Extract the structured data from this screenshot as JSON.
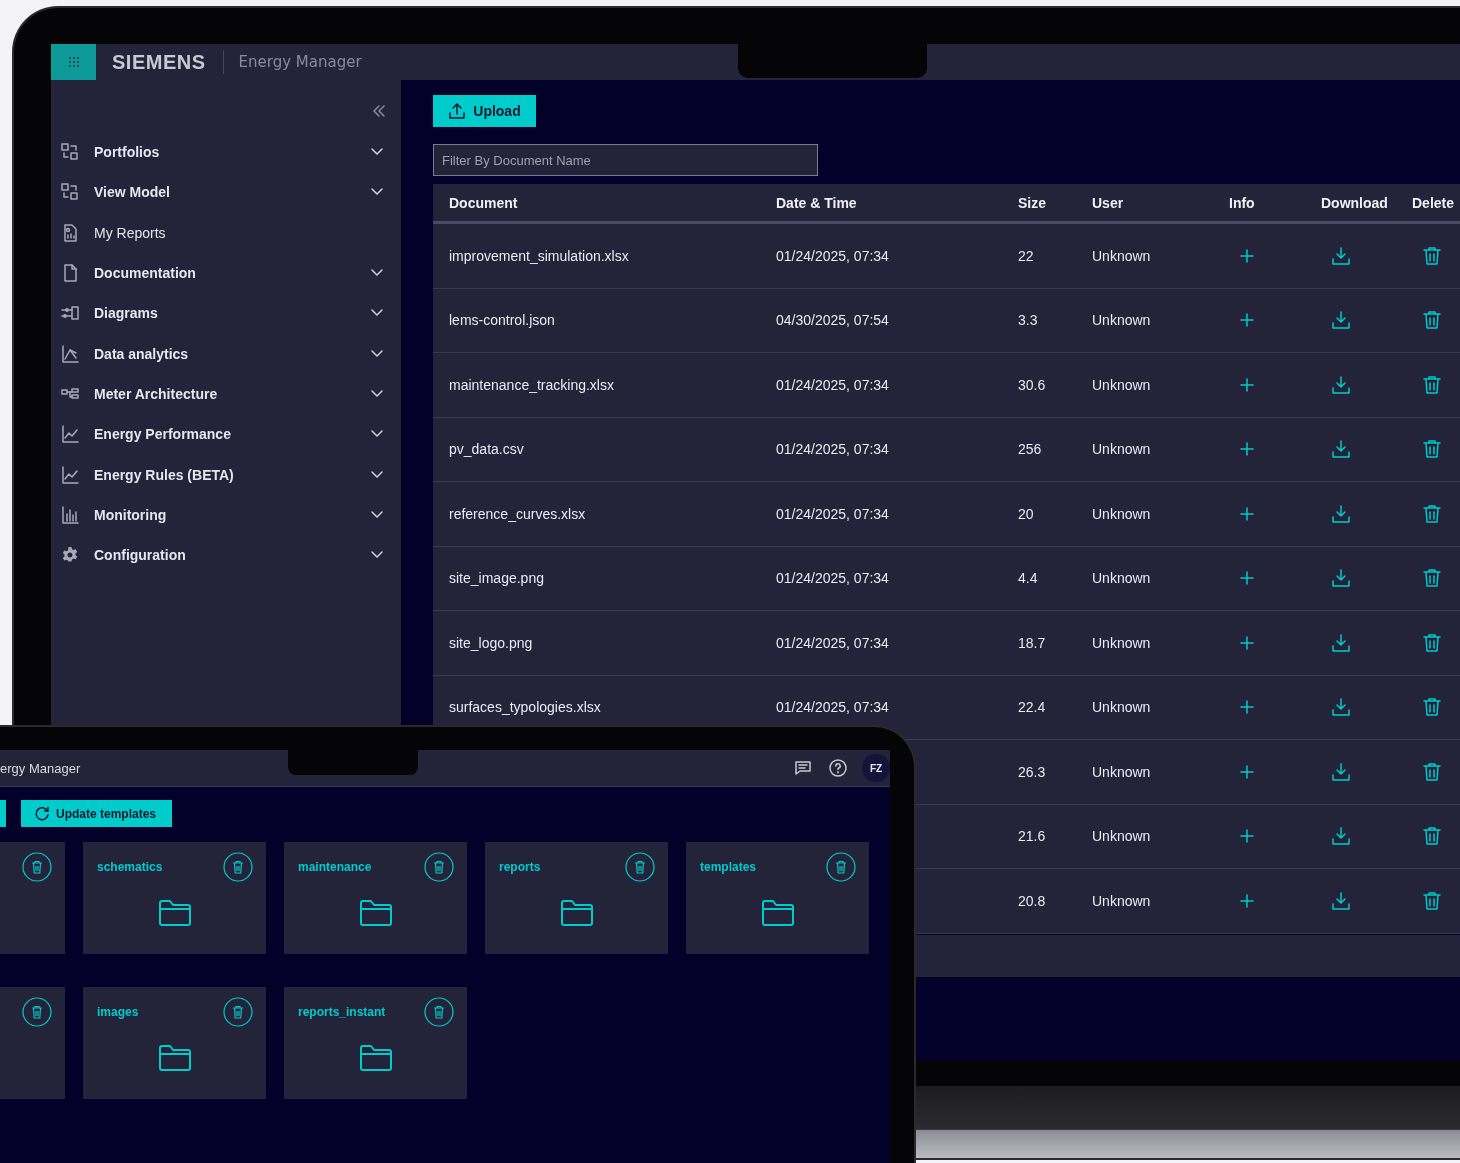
{
  "laptop": {
    "header": {
      "brand": "SIEMENS",
      "app_title": "Energy Manager"
    },
    "sidebar": {
      "items": [
        {
          "label": "Portfolios",
          "kind": "group"
        },
        {
          "label": "View Model",
          "kind": "group"
        },
        {
          "label": "My Reports",
          "kind": "link"
        },
        {
          "label": "Documentation",
          "kind": "group"
        },
        {
          "label": "Diagrams",
          "kind": "group"
        },
        {
          "label": "Data analytics",
          "kind": "group"
        },
        {
          "label": "Meter Architecture",
          "kind": "group"
        },
        {
          "label": "Energy Performance",
          "kind": "group"
        },
        {
          "label": "Energy Rules (BETA)",
          "kind": "group"
        },
        {
          "label": "Monitoring",
          "kind": "group"
        },
        {
          "label": "Configuration",
          "kind": "group"
        }
      ]
    },
    "upload_button": {
      "label": "Upload"
    },
    "filter": {
      "placeholder": "Filter By Document Name"
    },
    "table": {
      "columns": [
        "Document",
        "Date & Time",
        "Size",
        "User",
        "Info",
        "Download",
        "Delete"
      ],
      "rows": [
        {
          "document": "improvement_simulation.xlsx",
          "date_time": "01/24/2025, 07:34",
          "size": "22",
          "user": "Unknown"
        },
        {
          "document": "lems-control.json",
          "date_time": "04/30/2025, 07:54",
          "size": "3.3",
          "user": "Unknown"
        },
        {
          "document": "maintenance_tracking.xlsx",
          "date_time": "01/24/2025, 07:34",
          "size": "30.6",
          "user": "Unknown"
        },
        {
          "document": "pv_data.csv",
          "date_time": "01/24/2025, 07:34",
          "size": "256",
          "user": "Unknown"
        },
        {
          "document": "reference_curves.xlsx",
          "date_time": "01/24/2025, 07:34",
          "size": "20",
          "user": "Unknown"
        },
        {
          "document": "site_image.png",
          "date_time": "01/24/2025, 07:34",
          "size": "4.4",
          "user": "Unknown"
        },
        {
          "document": "site_logo.png",
          "date_time": "01/24/2025, 07:34",
          "size": "18.7",
          "user": "Unknown"
        },
        {
          "document": "surfaces_typologies.xlsx",
          "date_time": "01/24/2025, 07:34",
          "size": "22.4",
          "user": "Unknown"
        },
        {
          "size": "26.3",
          "user": "Unknown"
        },
        {
          "size": "21.6",
          "user": "Unknown"
        },
        {
          "size": "20.8",
          "user": "Unknown"
        }
      ]
    }
  },
  "tablet": {
    "header": {
      "app_title": "ergy Manager",
      "avatar": "FZ"
    },
    "update_button": {
      "label": "Update templates"
    },
    "folder_rows": [
      [
        {},
        {
          "name": "schematics"
        },
        {
          "name": "maintenance"
        },
        {
          "name": "reports"
        },
        {
          "name": "templates"
        }
      ],
      [
        {},
        {
          "name": "images"
        },
        {
          "name": "reports_instant"
        }
      ]
    ]
  }
}
